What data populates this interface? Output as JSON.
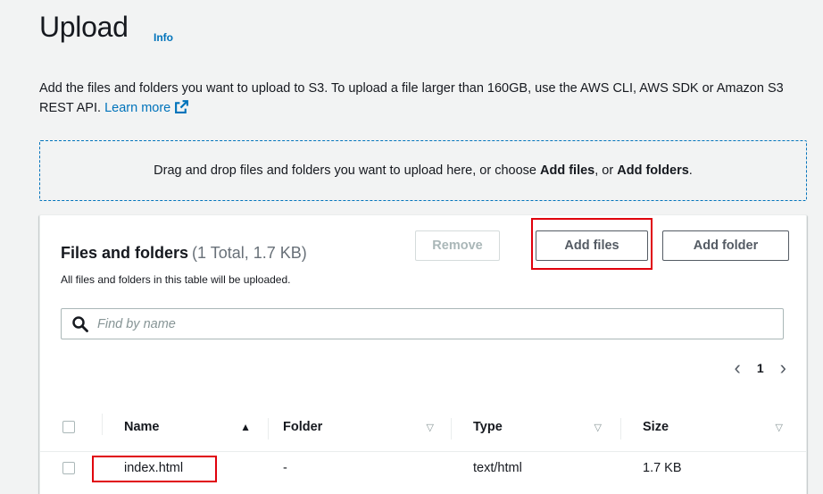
{
  "header": {
    "title": "Upload",
    "info_link": "Info",
    "description": "Add the files and folders you want to upload to S3. To upload a file larger than 160GB, use the AWS CLI, AWS SDK or Amazon S3 REST API.",
    "learn_more": "Learn more"
  },
  "dropzone": {
    "text_before": "Drag and drop files and folders you want to upload here, or choose ",
    "add_files": "Add files",
    "text_mid": ", or ",
    "add_folders": "Add folders",
    "text_end": "."
  },
  "panel": {
    "title": "Files and folders",
    "count": "(1 Total, 1.7 KB)",
    "subtitle": "All files and folders in this table will be uploaded.",
    "buttons": {
      "remove": "Remove",
      "add_files": "Add files",
      "add_folder": "Add folder"
    },
    "search": {
      "placeholder": "Find by name",
      "value": ""
    },
    "pagination": {
      "prev": "‹",
      "current_page": "1",
      "next": "›"
    },
    "table": {
      "columns": [
        "Name",
        "Folder",
        "Type",
        "Size"
      ],
      "rows": [
        {
          "name": "index.html",
          "folder": "-",
          "type": "text/html",
          "size": "1.7 KB"
        }
      ]
    }
  },
  "colors": {
    "link": "#0073bb",
    "highlight": "#e0000c",
    "background": "#f2f3f3"
  },
  "icons": {
    "external_link": "external-link-icon",
    "search": "search-icon",
    "sort_ascending": "sort-ascending-icon",
    "sort_neutral": "sort-neutral-icon"
  }
}
